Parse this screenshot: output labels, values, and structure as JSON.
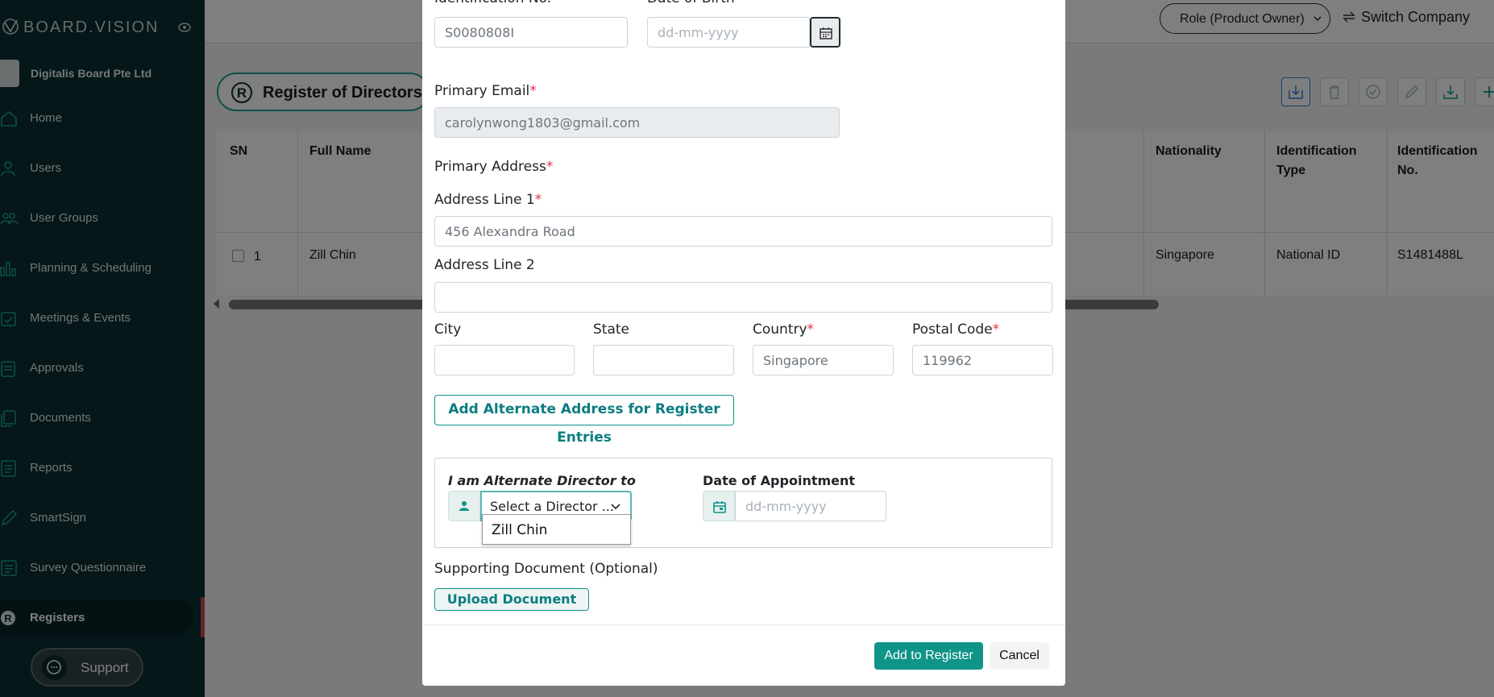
{
  "app": {
    "logo_text": "BOARD.VISION",
    "company": "Digitalis Board Pte Ltd"
  },
  "sidebar": {
    "items": [
      {
        "label": "Home",
        "icon": "home-icon"
      },
      {
        "label": "Users",
        "icon": "user-icon"
      },
      {
        "label": "User Groups",
        "icon": "users-icon"
      },
      {
        "label": "Planning & Scheduling",
        "icon": "bar-chart-icon"
      },
      {
        "label": "Meetings & Events",
        "icon": "calendar-check-icon"
      },
      {
        "label": "Approvals",
        "icon": "approval-icon"
      },
      {
        "label": "Documents",
        "icon": "documents-icon"
      },
      {
        "label": "Reports",
        "icon": "report-icon"
      },
      {
        "label": "SmartSign",
        "icon": "pen-icon"
      },
      {
        "label": "Survey Questionnaire",
        "icon": "survey-icon"
      },
      {
        "label": "Registers",
        "icon": "registers-icon",
        "active": true
      }
    ],
    "support_label": "Support"
  },
  "topbar": {
    "role": "Role (Product Owner)",
    "switch_company": "Switch Company"
  },
  "page": {
    "register_title": "Register of Directors",
    "register_badge": "R"
  },
  "table": {
    "headers": {
      "sn": "SN",
      "full_name": "Full Name",
      "nationality": "Nationality",
      "id_type": "Identification Type",
      "id_no": "Identification No."
    },
    "rows": [
      {
        "sn": "1",
        "full_name": "Zill Chin",
        "nationality": "Singapore",
        "id_type": "National ID",
        "id_no": "S1481488L"
      }
    ]
  },
  "modal": {
    "identification_label": "Identification No.",
    "identification_value": "S0080808I",
    "dob_label": "Date of Birth",
    "dob_placeholder": "dd-mm-yyyy",
    "email_label": "Primary Email",
    "email_value": "carolynwong1803@gmail.com",
    "address_heading": "Primary Address",
    "address1_label": "Address Line 1",
    "address1_value": "456 Alexandra Road",
    "address2_label": "Address Line 2",
    "address2_value": "",
    "city_label": "City",
    "state_label": "State",
    "country_label": "Country",
    "country_value": "Singapore",
    "postal_label": "Postal Code",
    "postal_value": "119962",
    "alt_address_button": "Add Alternate Address for Register Entries",
    "alt_director_label": "I am Alternate Director to",
    "director_select_value": "Select a Director ...",
    "director_options": [
      "Zill Chin"
    ],
    "appointment_label": "Date of Appointment",
    "appointment_placeholder": "dd-mm-yyyy",
    "supporting_doc_label": "Supporting Document (Optional)",
    "upload_button": "Upload Document",
    "add_button": "Add to Register",
    "cancel_button": "Cancel",
    "required_mark": "*"
  },
  "colors": {
    "sidebar_bg": "#0b2e31",
    "accent": "#0f9488",
    "required": "#dc3545",
    "active_indicator": "#c64848"
  }
}
